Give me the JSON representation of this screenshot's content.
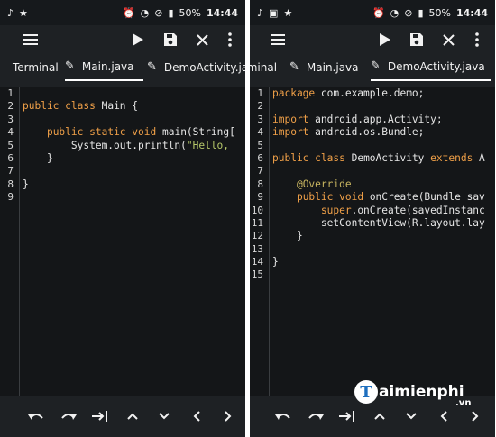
{
  "status": {
    "time": "14:44",
    "battery": "50%",
    "left_icons": [
      "tiktok-icon",
      "star-icon"
    ],
    "right_icons": [
      "alarm-icon",
      "wifi-icon",
      "mute-icon",
      "battery-icon"
    ]
  },
  "left": {
    "tabs": [
      "Terminal",
      "Main.java",
      "DemoActivity.java"
    ],
    "active_tab": "Main.java",
    "line_numbers": [
      "1",
      "2",
      "3",
      "4",
      "5",
      "6",
      "7",
      "8",
      "9"
    ],
    "code": {
      "l2_kw1": "public",
      "l2_kw2": "class",
      "l2_rest": " Main {",
      "l4_kw1": "public",
      "l4_kw2": "static",
      "l4_kw3": "void",
      "l4_rest": " main(String[",
      "l5_a": "System.out.println(",
      "l5_str": "\"Hello,",
      "l6": "}",
      "l8": "}"
    }
  },
  "right": {
    "tabs": [
      "rminal",
      "Main.java",
      "DemoActivity.java"
    ],
    "active_tab": "DemoActivity.java",
    "line_numbers": [
      "1",
      "2",
      "3",
      "4",
      "5",
      "6",
      "7",
      "8",
      "9",
      "10",
      "11",
      "12",
      "13",
      "14",
      "15"
    ],
    "code": {
      "l1_kw": "package",
      "l1_rest": " com.example.demo;",
      "l3_kw": "import",
      "l3_rest": " android.app.Activity;",
      "l4_kw": "import",
      "l4_rest": " android.os.Bundle;",
      "l6_kw1": "public",
      "l6_kw2": "class",
      "l6_mid": " DemoActivity ",
      "l6_kw3": "extends",
      "l6_end": " A",
      "l8_ann": "@Override",
      "l9_kw1": "public",
      "l9_kw2": "void",
      "l9_rest": " onCreate(Bundle sav",
      "l10_kw": "super",
      "l10_rest": ".onCreate(savedInstanc",
      "l11": "setContentView(R.layout.lay",
      "l12": "}",
      "l14": "}"
    }
  },
  "watermark": {
    "letter": "T",
    "name": "aimienphi",
    "suffix": ".vn"
  },
  "colors": {
    "background": "#1e2124",
    "editor": "#141618",
    "keyword": "#f0a048",
    "annotation": "#c8b560",
    "string": "#b6c86a",
    "cursor": "#3fe0c8"
  }
}
